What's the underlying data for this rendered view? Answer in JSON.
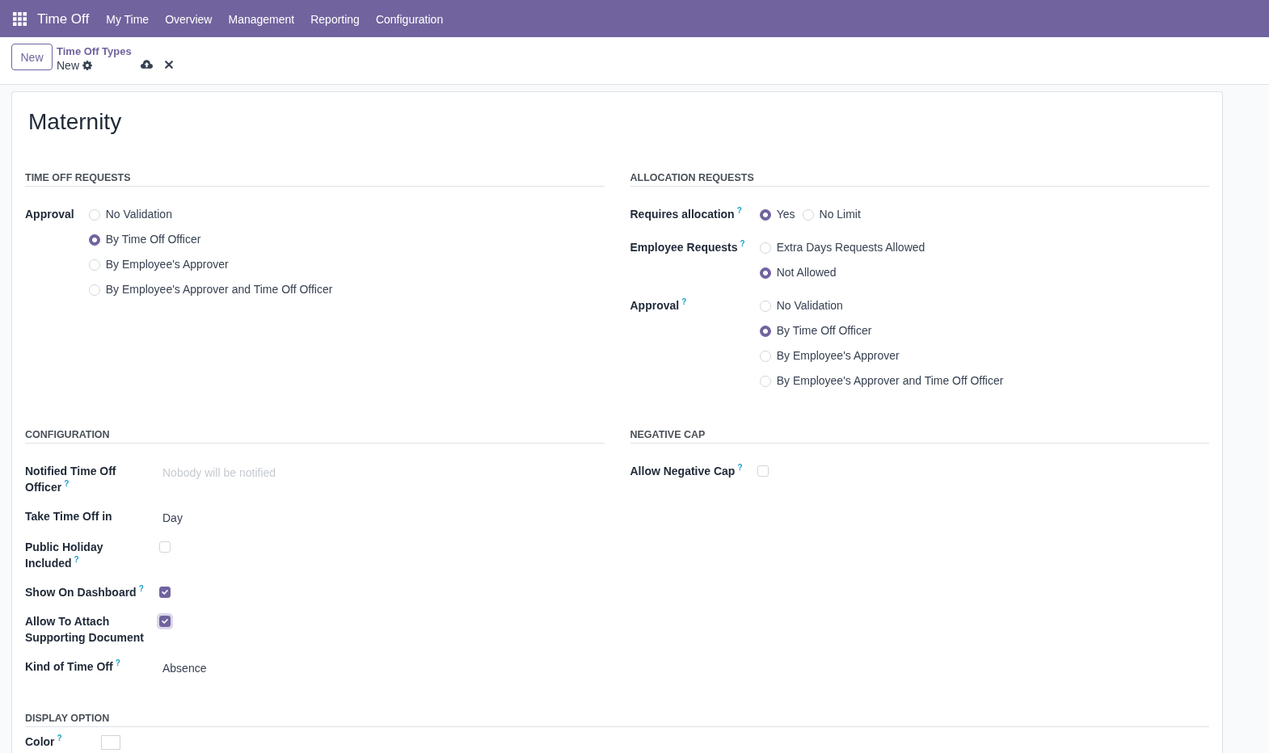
{
  "navbar": {
    "app_name": "Time Off",
    "menu": [
      "My Time",
      "Overview",
      "Management",
      "Reporting",
      "Configuration"
    ]
  },
  "control_panel": {
    "new_button": "New",
    "breadcrumb": "Time Off Types",
    "record_name": "New"
  },
  "sheet": {
    "title": "Maternity",
    "sections": [
      {
        "title": "TIME OFF REQUESTS",
        "wide": false,
        "fields": [
          {
            "kind": "radio",
            "label": "Approval",
            "horizontal": false,
            "options": [
              {
                "label": "No Validation",
                "selected": false
              },
              {
                "label": "By Time Off Officer",
                "selected": true
              },
              {
                "label": "By Employee's Approver",
                "selected": false
              },
              {
                "label": "By Employee's Approver and Time Off Officer",
                "selected": false
              }
            ]
          }
        ]
      },
      {
        "title": "ALLOCATION REQUESTS",
        "wide": false,
        "fields": [
          {
            "kind": "radio",
            "label": "Requires allocation",
            "help": "?",
            "horizontal": true,
            "options": [
              {
                "label": "Yes",
                "selected": true
              },
              {
                "label": "No Limit",
                "selected": false
              }
            ]
          },
          {
            "kind": "radio",
            "label": "Employee Requests",
            "help": "?",
            "horizontal": false,
            "options": [
              {
                "label": "Extra Days Requests Allowed",
                "selected": false
              },
              {
                "label": "Not Allowed",
                "selected": true
              }
            ]
          },
          {
            "kind": "radio",
            "label": "Approval",
            "help": "?",
            "horizontal": false,
            "options": [
              {
                "label": "No Validation",
                "selected": false
              },
              {
                "label": "By Time Off Officer",
                "selected": true
              },
              {
                "label": "By Employee's Approver",
                "selected": false
              },
              {
                "label": "By Employee's Approver and Time Off Officer",
                "selected": false
              }
            ]
          }
        ]
      },
      {
        "title": "CONFIGURATION",
        "wide": false,
        "fields": [
          {
            "kind": "many2one",
            "label": "Notified Time Off Officer",
            "help": "?",
            "placeholder": "Nobody will be notified"
          },
          {
            "kind": "select",
            "label": "Take Time Off in",
            "value": "Day"
          },
          {
            "kind": "checkbox",
            "label": "Public Holiday Included",
            "help": "?",
            "checked": false,
            "focused": false
          },
          {
            "kind": "checkbox",
            "label": "Show On Dashboard",
            "help": "?",
            "checked": true,
            "focused": false
          },
          {
            "kind": "checkbox",
            "label": "Allow To Attach Supporting Document",
            "checked": true,
            "focused": true
          },
          {
            "kind": "select",
            "label": "Kind of Time Off",
            "help": "?",
            "value": "Absence"
          }
        ]
      },
      {
        "title": "NEGATIVE CAP",
        "wide": false,
        "fields": [
          {
            "kind": "checkbox",
            "label": "Allow Negative Cap",
            "help": "?",
            "checked": false,
            "focused": false
          }
        ]
      },
      {
        "title": "DISPLAY OPTION",
        "wide": true,
        "fields": [
          {
            "kind": "color",
            "label": "Color",
            "help": "?"
          }
        ]
      }
    ]
  }
}
